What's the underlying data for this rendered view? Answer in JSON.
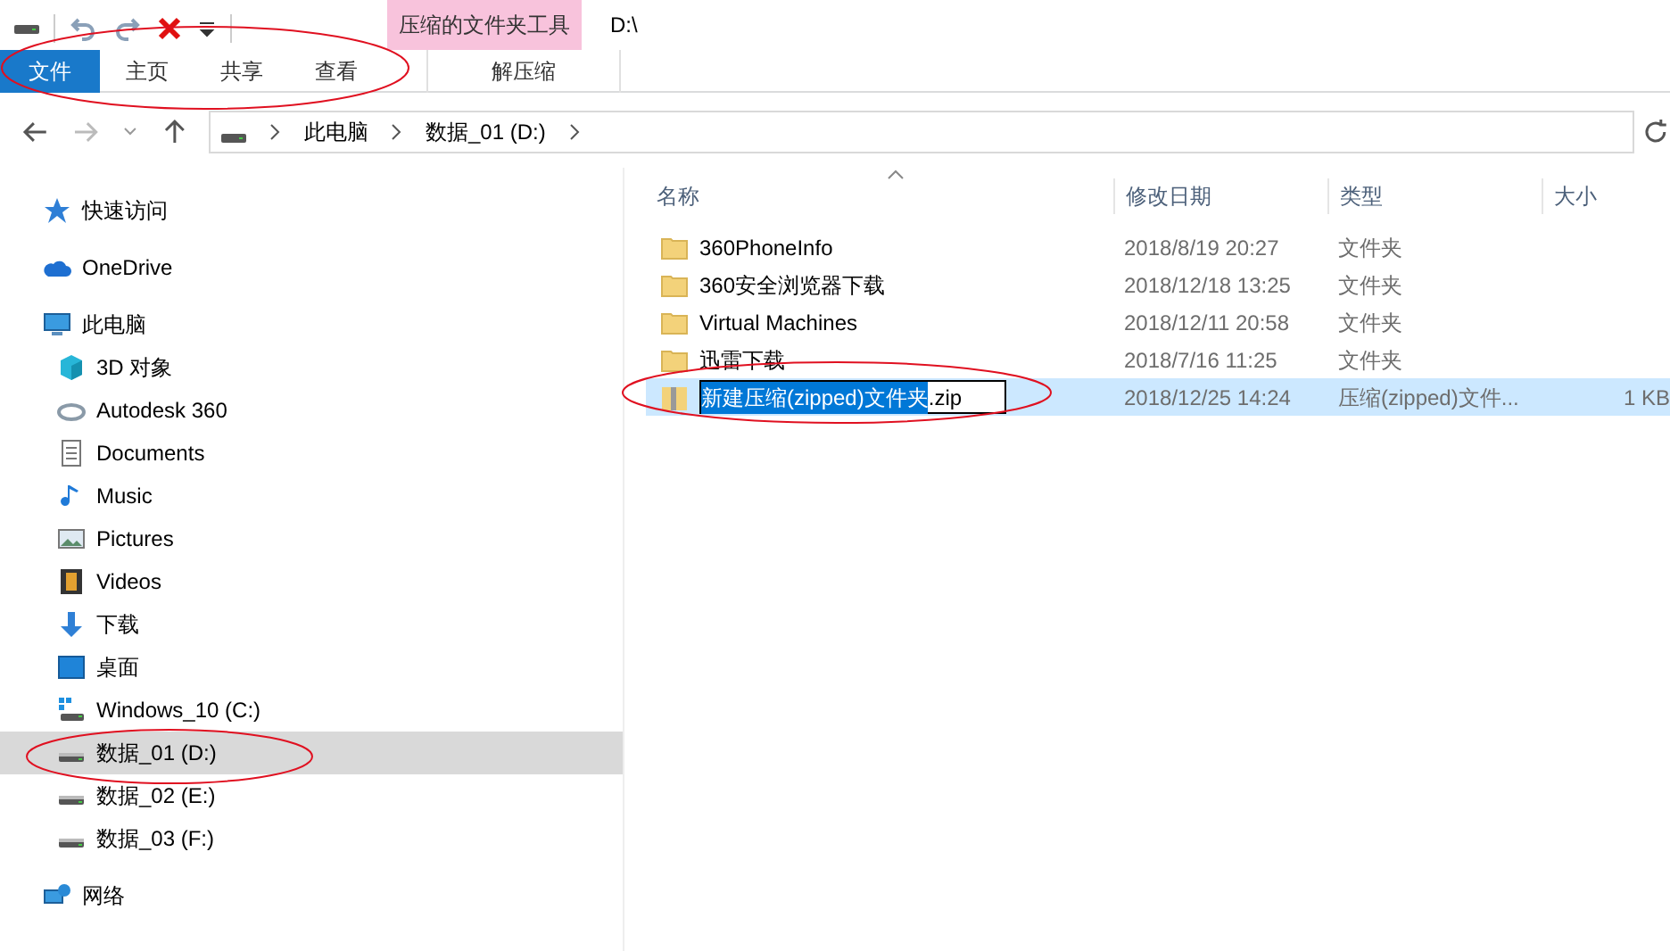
{
  "title_bar": {
    "contextual_tab": "压缩的文件夹工具",
    "title": "D:\\"
  },
  "ribbon_tabs": [
    {
      "label": "文件",
      "selected": true,
      "kind": "file"
    },
    {
      "label": "主页",
      "selected": false,
      "kind": "tab"
    },
    {
      "label": "共享",
      "selected": false,
      "kind": "tab"
    },
    {
      "label": "查看",
      "selected": false,
      "kind": "tab"
    },
    {
      "label": "解压缩",
      "selected": false,
      "kind": "contextual"
    }
  ],
  "address_bar": {
    "segments": [
      "此电脑",
      "数据_01 (D:)"
    ]
  },
  "sidebar": {
    "items": [
      {
        "label": "快速访问",
        "kind": "star",
        "selected": false
      },
      {
        "label": "OneDrive",
        "kind": "cloud",
        "selected": false
      },
      {
        "label": "此电脑",
        "kind": "pc",
        "selected": false,
        "children": [
          {
            "label": "3D 对象",
            "kind": "cube",
            "selected": false
          },
          {
            "label": "Autodesk 360",
            "kind": "autodesk",
            "selected": false
          },
          {
            "label": "Documents",
            "kind": "document",
            "selected": false
          },
          {
            "label": "Music",
            "kind": "music",
            "selected": false
          },
          {
            "label": "Pictures",
            "kind": "picture",
            "selected": false
          },
          {
            "label": "Videos",
            "kind": "video",
            "selected": false
          },
          {
            "label": "下载",
            "kind": "download",
            "selected": false
          },
          {
            "label": "桌面",
            "kind": "desktop",
            "selected": false
          },
          {
            "label": "Windows_10 (C:)",
            "kind": "windrive",
            "selected": false
          },
          {
            "label": "数据_01 (D:)",
            "kind": "drive",
            "selected": true
          },
          {
            "label": "数据_02 (E:)",
            "kind": "drive",
            "selected": false
          },
          {
            "label": "数据_03 (F:)",
            "kind": "drive",
            "selected": false
          }
        ]
      },
      {
        "label": "网络",
        "kind": "network",
        "selected": false
      }
    ]
  },
  "file_list": {
    "columns": [
      "名称",
      "修改日期",
      "类型",
      "大小"
    ],
    "rows": [
      {
        "kind": "folder",
        "name": "360PhoneInfo",
        "date": "2018/8/19 20:27",
        "type": "文件夹",
        "selected": false
      },
      {
        "kind": "folder",
        "name": "360安全浏览器下载",
        "date": "2018/12/18 13:25",
        "type": "文件夹",
        "selected": false
      },
      {
        "kind": "folder",
        "name": "Virtual Machines",
        "date": "2018/12/11 20:58",
        "type": "文件夹",
        "selected": false
      },
      {
        "kind": "folder",
        "name": "迅雷下载",
        "date": "2018/7/16 11:25",
        "type": "文件夹",
        "selected": false
      },
      {
        "kind": "zip",
        "rename": {
          "highlighted": "新建压缩(zipped)文件夹",
          "rest": ".zip"
        },
        "date": "2018/12/25 14:24",
        "type": "压缩(zipped)文件...",
        "size": "1 KB",
        "selected": true
      }
    ]
  }
}
